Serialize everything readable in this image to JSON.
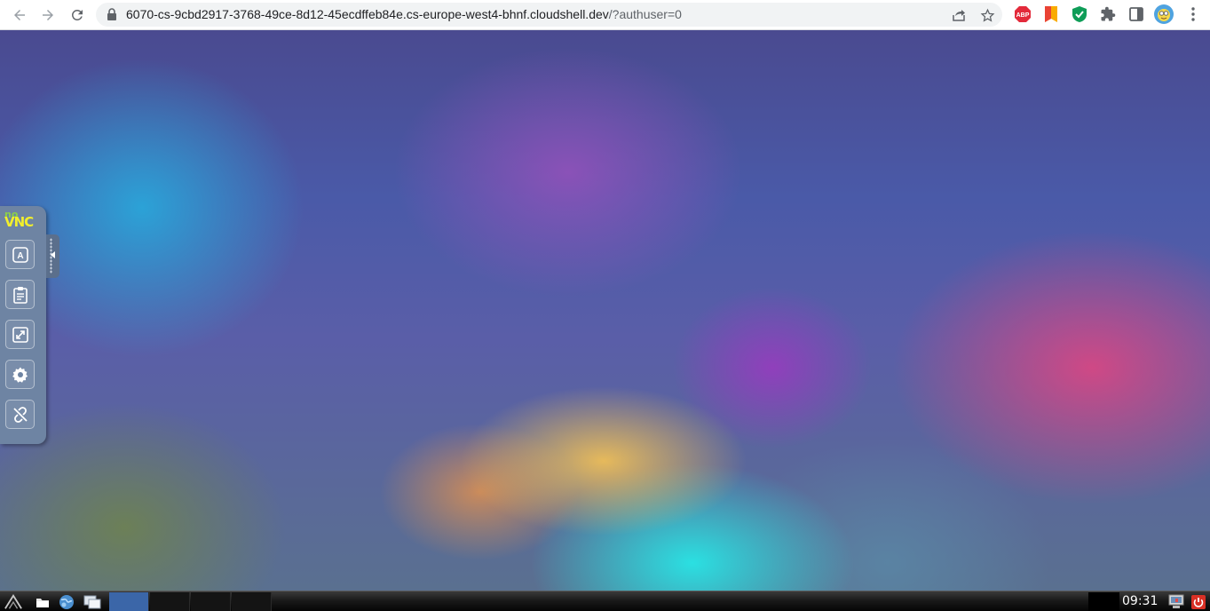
{
  "browser": {
    "url_main": "6070-cs-9cbd2917-3768-49ce-8d12-45ecdffeb84e.cs-europe-west4-bhnf.cloudshell.dev",
    "url_query": "/?authuser=0",
    "icons": {
      "back": "arrow-left-icon",
      "forward": "arrow-right-icon",
      "reload": "reload-icon",
      "lock": "lock-icon",
      "share": "share-icon",
      "bookmark": "star-icon",
      "menu": "kebab-menu-icon"
    },
    "extensions": {
      "adblock_label": "ABP",
      "colors": {
        "adblock": "#e32a3b",
        "bookmark_ext": "#f9ab00",
        "shield": "#0f9d58",
        "puzzle": "#5f6368"
      }
    }
  },
  "novnc": {
    "logo_no": "no",
    "logo_vnc": "VNC",
    "keyboard_glyph": "A",
    "buttons": [
      "keyboard",
      "clipboard",
      "fullscreen",
      "settings",
      "disconnect"
    ],
    "colors": {
      "panel": "#6e84a3",
      "logo_no": "#8bd04a",
      "logo_vnc": "#f2ef2c"
    }
  },
  "taskbar": {
    "clock": "09:31",
    "task_count": 4,
    "active_task_color": "#3b66a8",
    "icons": [
      "app-menu-icon",
      "file-manager-icon",
      "web-browser-icon",
      "show-desktop-icon",
      "network-monitor-icon",
      "power-icon"
    ]
  }
}
